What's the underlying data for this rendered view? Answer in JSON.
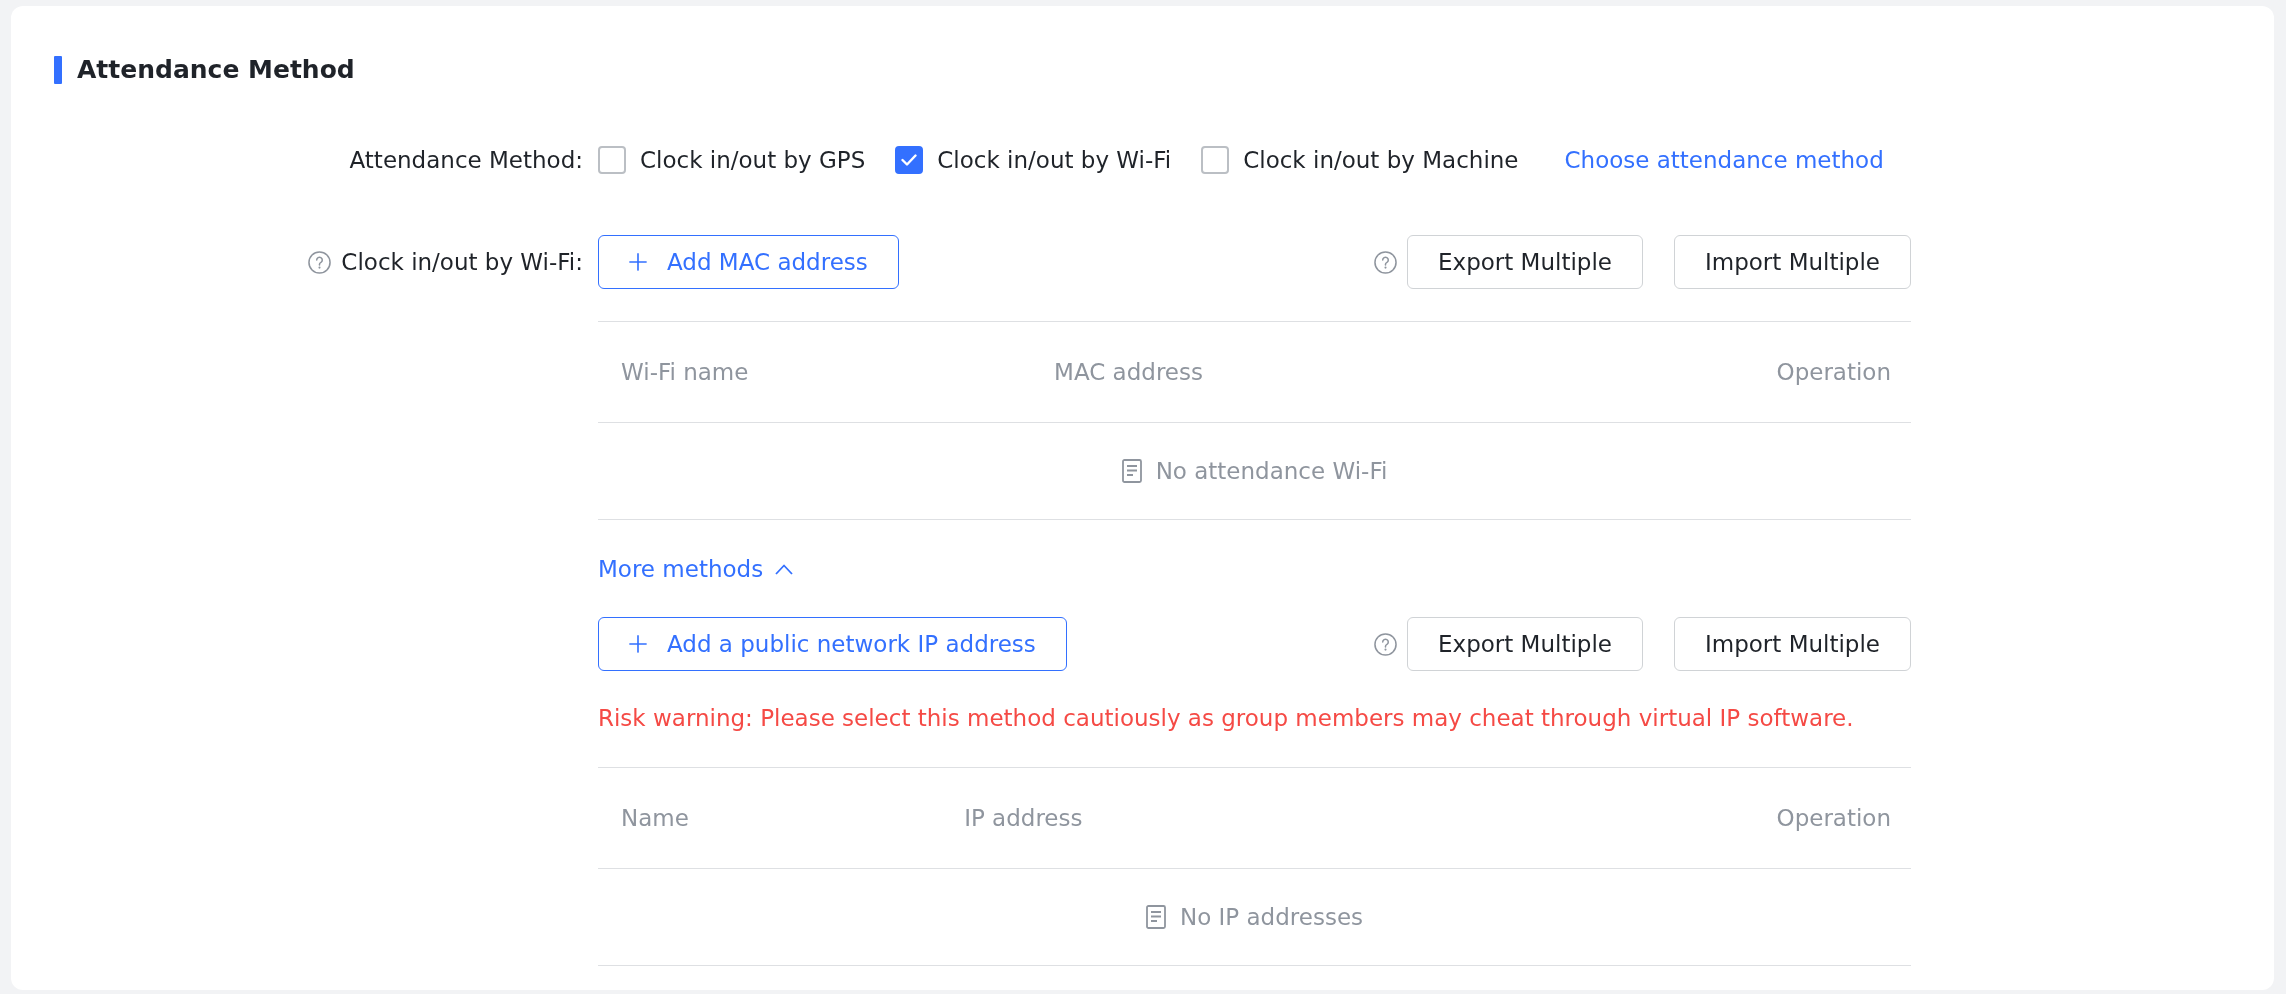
{
  "section": {
    "title": "Attendance Method"
  },
  "attendance_method": {
    "label": "Attendance Method:",
    "options": [
      {
        "label": "Clock in/out by GPS",
        "checked": false
      },
      {
        "label": "Clock in/out by Wi-Fi",
        "checked": true
      },
      {
        "label": "Clock in/out by Machine",
        "checked": false
      }
    ],
    "link": "Choose attendance method"
  },
  "wifi": {
    "label": "Clock in/out by Wi-Fi:",
    "add_button": "Add MAC address",
    "export_button": "Export Multiple",
    "import_button": "Import Multiple",
    "table": {
      "columns": [
        "Wi-Fi name",
        "MAC address",
        "Operation"
      ],
      "empty_text": "No attendance Wi-Fi"
    }
  },
  "more_methods": {
    "label": "More methods",
    "expanded": true
  },
  "public_ip": {
    "add_button": "Add a public network IP address",
    "export_button": "Export Multiple",
    "import_button": "Import Multiple",
    "warning": "Risk warning: Please select this method cautiously as group members may cheat through virtual IP software.",
    "table": {
      "columns": [
        "Name",
        "IP address",
        "Operation"
      ],
      "empty_text": "No IP addresses"
    }
  }
}
